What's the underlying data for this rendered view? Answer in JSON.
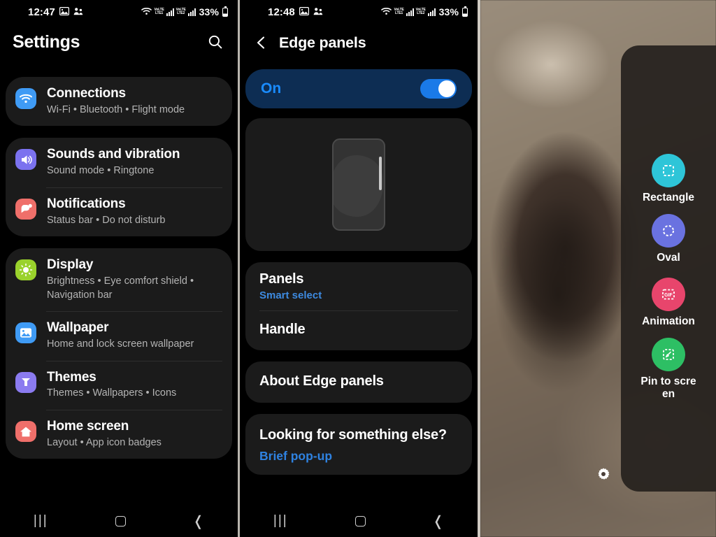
{
  "status_left": {
    "time_left": "12:47",
    "time_mid": "12:48",
    "icons": [
      "image-icon",
      "share-people-icon"
    ]
  },
  "status_right": {
    "wifi": "wifi-icon",
    "sim1_label_top": "VoLTE",
    "sim1_label_bottom": "LTE1",
    "sim2_label_top": "VoLTE",
    "sim2_label_bottom": "LTE2",
    "battery_percent": "33%"
  },
  "left_screen": {
    "title": "Settings",
    "search_icon": "search-icon",
    "cards": [
      {
        "rows": [
          {
            "icon": "wifi-icon",
            "icon_color": "#3f9bf5",
            "title": "Connections",
            "subtitle": "Wi-Fi  •  Bluetooth  •  Flight mode"
          }
        ]
      },
      {
        "rows": [
          {
            "icon": "speaker-icon",
            "icon_color": "#7b72ef",
            "title": "Sounds and vibration",
            "subtitle": "Sound mode  •  Ringtone"
          },
          {
            "icon": "notification-icon",
            "icon_color": "#ef6f6a",
            "title": "Notifications",
            "subtitle": "Status bar  •  Do not disturb"
          }
        ]
      },
      {
        "rows": [
          {
            "icon": "brightness-icon",
            "icon_color": "#9ad22c",
            "title": "Display",
            "subtitle": "Brightness  •  Eye comfort shield  •  Navigation bar"
          },
          {
            "icon": "wallpaper-icon",
            "icon_color": "#3f9bf5",
            "title": "Wallpaper",
            "subtitle": "Home and lock screen wallpaper"
          },
          {
            "icon": "themes-icon",
            "icon_color": "#8b7bf0",
            "title": "Themes",
            "subtitle": "Themes  •  Wallpapers  •  Icons"
          },
          {
            "icon": "home-icon",
            "icon_color": "#ef6f6a",
            "title": "Home screen",
            "subtitle": "Layout  •  App icon badges"
          }
        ]
      }
    ]
  },
  "mid_screen": {
    "back_icon": "chevron-left-icon",
    "title": "Edge panels",
    "toggle_label": "On",
    "toggle_on": true,
    "toggle_color": "#1a7ae8",
    "preview_icon": "phone-preview-illustration",
    "rows": [
      {
        "title": "Panels",
        "subtitle": "Smart select"
      },
      {
        "title": "Handle",
        "subtitle": ""
      }
    ],
    "about_row": {
      "title": "About Edge panels"
    },
    "looking_card": {
      "title": "Looking for something else?",
      "link": "Brief pop-up"
    }
  },
  "right_screen": {
    "drawer_items": [
      {
        "label": "Rectangle",
        "icon": "rectangle-select-icon",
        "color": "#2ec5d8"
      },
      {
        "label": "Oval",
        "icon": "oval-select-icon",
        "color": "#6a72e0"
      },
      {
        "label": "Animation",
        "icon": "gif-icon",
        "color": "#e8456c"
      },
      {
        "label": "Pin to screen",
        "icon": "pin-icon",
        "color": "#2dbf64"
      }
    ],
    "settings_icon": "gear-icon"
  },
  "navbar": {
    "recent_icon": "recents-icon",
    "recent_glyph": "|||",
    "home_icon": "home-square-icon",
    "back_icon": "back-chevron-icon",
    "back_glyph": "❬"
  }
}
